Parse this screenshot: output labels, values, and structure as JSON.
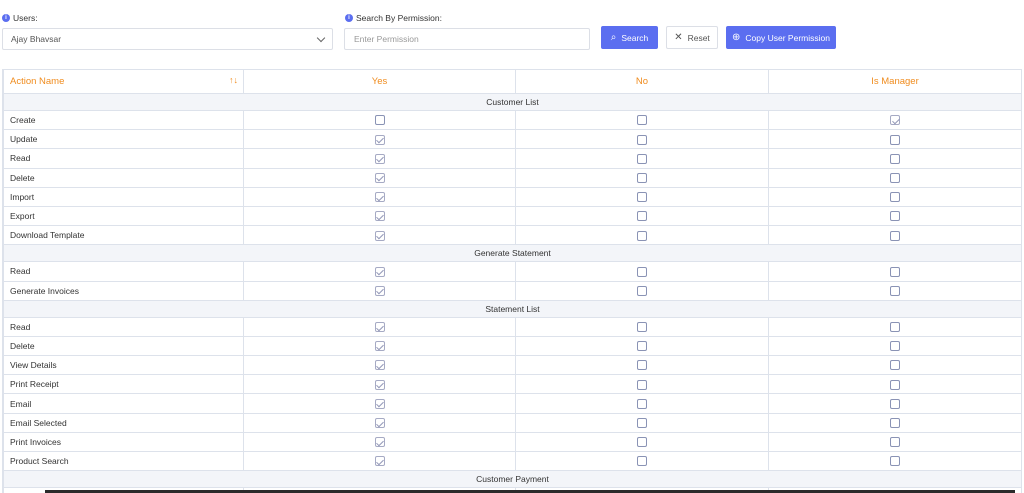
{
  "filters": {
    "users_label": "Users:",
    "users_value": "Ajay Bhavsar",
    "search_label": "Search By Permission:",
    "search_placeholder": "Enter Permission",
    "search_value": ""
  },
  "buttons": {
    "search": "Search",
    "reset": "Reset",
    "copy": "Copy User Permission"
  },
  "colors": {
    "accent": "#5b6ef0",
    "header_text": "#f08c1e",
    "section_bg": "#f3f5f9"
  },
  "table": {
    "columns": [
      "Action Name",
      "Yes",
      "No",
      "Is Manager"
    ],
    "sections": [
      {
        "title": "Customer List",
        "rows": [
          {
            "name": "Create",
            "yes": false,
            "no": false,
            "manager": true
          },
          {
            "name": "Update",
            "yes": true,
            "no": false,
            "manager": false
          },
          {
            "name": "Read",
            "yes": true,
            "no": false,
            "manager": false
          },
          {
            "name": "Delete",
            "yes": true,
            "no": false,
            "manager": false
          },
          {
            "name": "Import",
            "yes": true,
            "no": false,
            "manager": false
          },
          {
            "name": "Export",
            "yes": true,
            "no": false,
            "manager": false
          },
          {
            "name": "Download Template",
            "yes": true,
            "no": false,
            "manager": false
          }
        ]
      },
      {
        "title": "Generate Statement",
        "rows": [
          {
            "name": "Read",
            "yes": true,
            "no": false,
            "manager": false
          },
          {
            "name": "Generate Invoices",
            "yes": true,
            "no": false,
            "manager": false
          }
        ]
      },
      {
        "title": "Statement List",
        "rows": [
          {
            "name": "Read",
            "yes": true,
            "no": false,
            "manager": false
          },
          {
            "name": "Delete",
            "yes": true,
            "no": false,
            "manager": false
          },
          {
            "name": "View Details",
            "yes": true,
            "no": false,
            "manager": false
          },
          {
            "name": "Print Receipt",
            "yes": true,
            "no": false,
            "manager": false
          },
          {
            "name": "Email",
            "yes": true,
            "no": false,
            "manager": false
          },
          {
            "name": "Email Selected",
            "yes": true,
            "no": false,
            "manager": false
          },
          {
            "name": "Print Invoices",
            "yes": true,
            "no": false,
            "manager": false
          },
          {
            "name": "Product Search",
            "yes": true,
            "no": false,
            "manager": false
          }
        ]
      },
      {
        "title": "Customer Payment",
        "rows": [
          {
            "name": "",
            "yes": true,
            "no": false,
            "manager": false
          }
        ]
      }
    ]
  }
}
